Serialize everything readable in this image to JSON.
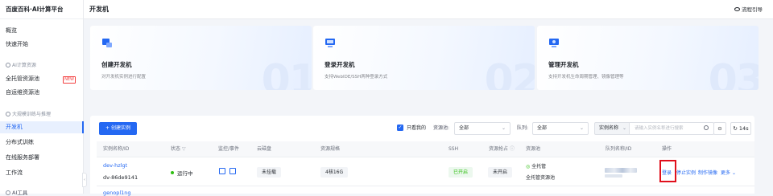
{
  "brand": "百度百科·AI计算平台",
  "sidebar": {
    "items": [
      {
        "label": "概览"
      },
      {
        "label": "快速开始"
      }
    ],
    "group1": "AI计算资源",
    "group1_items": [
      {
        "label": "全托管资源池",
        "badge": "NEW"
      },
      {
        "label": "自运维资源池"
      }
    ],
    "group2": "大规模训练与推理",
    "group2_items": [
      {
        "label": "开发机"
      },
      {
        "label": "分布式训练"
      },
      {
        "label": "在线服务部署"
      },
      {
        "label": "工作流"
      }
    ],
    "footer": "AI工具"
  },
  "header": {
    "title": "开发机",
    "guide": "流程引导"
  },
  "cards": [
    {
      "title": "创建开发机",
      "desc": "对开发机实例进行配置",
      "num": "01"
    },
    {
      "title": "登录开发机",
      "desc": "支持WebIDE/SSH两种登录方式",
      "num": "02"
    },
    {
      "title": "管理开发机",
      "desc": "支持开发机生命周期管理、镜像管理等",
      "num": "03"
    }
  ],
  "toolbar": {
    "create": "+ 创建实例",
    "only_mine": "只看我的",
    "pool_type_label": "资源池:",
    "pool_type_value": "全部",
    "queue_label": "队列:",
    "queue_value": "全部",
    "search_key": "实例名称",
    "search_placeholder": "请输入实例名称进行搜索",
    "refresh_interval": "14s"
  },
  "table": {
    "headers": [
      "实例名称/ID",
      "状态",
      "监控/事件",
      "云磁盘",
      "资源规格",
      "SSH",
      "资源抢占",
      "资源池",
      "队列名称/ID",
      "操作"
    ],
    "row": {
      "name": "dev-hzlgt",
      "id": "dv-86de9141",
      "status": "运行中",
      "disk": "未挂载",
      "spec": "4核16G",
      "ssh": "已开启",
      "preempt": "未开启",
      "pool_type": "全托管",
      "pool_name": "全托管资源池",
      "actions": [
        "登录",
        "停止实例",
        "制作镜像",
        "更多"
      ]
    },
    "next_row_name": "genopl1ng"
  },
  "colors": {
    "accent": "#2468f2",
    "running": "#30bf13",
    "highlight": "#e0101c"
  }
}
